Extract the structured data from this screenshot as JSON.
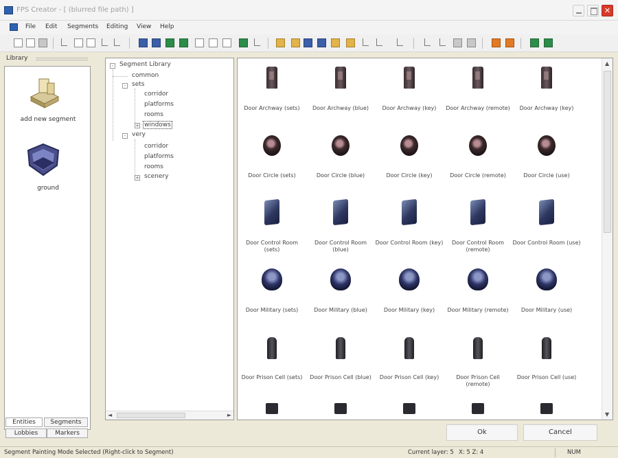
{
  "window": {
    "title": "FPS Creator - [ (blurred file path) ]",
    "close_glyph": "✕"
  },
  "menu": {
    "items": [
      "File",
      "Edit",
      "Segments",
      "Editing",
      "View",
      "Help"
    ]
  },
  "toolbar": {
    "icons": [
      "new-icon",
      "open-icon",
      "save-icon",
      "cut-icon",
      "copy-icon",
      "paste-icon",
      "undo-icon",
      "redo-icon",
      "view-icon",
      "map-icon",
      "build-icon",
      "test-icon",
      "entity-icon",
      "waypoint-icon",
      "zoom-icon",
      "draw-icon",
      "settings-icon",
      "help-icon",
      "play-icon"
    ]
  },
  "library": {
    "label": "Library",
    "items": [
      {
        "label": "add new segment",
        "icon": "add-segment-icon"
      },
      {
        "label": "ground",
        "icon": "ground-icon"
      }
    ],
    "tabs": [
      "Entities",
      "Segments",
      "Lobbies",
      "Markers"
    ]
  },
  "tree": {
    "root": "Segment Library",
    "nodes": [
      {
        "label": "common",
        "indent": 1
      },
      {
        "label": "sets",
        "indent": 1
      },
      {
        "label": "corridor",
        "indent": 2
      },
      {
        "label": "platforms",
        "indent": 2
      },
      {
        "label": "rooms",
        "indent": 2
      },
      {
        "label": "windows",
        "indent": 2,
        "selected": true
      },
      {
        "label": "very",
        "indent": 1
      },
      {
        "label": "corridor",
        "indent": 2
      },
      {
        "label": "platforms",
        "indent": 2
      },
      {
        "label": "rooms",
        "indent": 2
      },
      {
        "label": "scenery",
        "indent": 2
      }
    ]
  },
  "grid": {
    "rows": [
      {
        "shape": "arch",
        "labels": [
          "Door Archway (sets)",
          "Door Archway (blue)",
          "Door Archway (key)",
          "Door Archway (remote)",
          "Door Archway (key)"
        ]
      },
      {
        "shape": "round",
        "labels": [
          "Door Circle (sets)",
          "Door Circle (blue)",
          "Door Circle (key)",
          "Door Circle (remote)",
          "Door Circle (use)"
        ]
      },
      {
        "shape": "square",
        "labels": [
          "Door Control Room (sets)",
          "Door Control Room (blue)",
          "Door Control Room (key)",
          "Door Control Room (remote)",
          "Door Control Room (use)"
        ]
      },
      {
        "shape": "military",
        "labels": [
          "Door Military (sets)",
          "Door Military (blue)",
          "Door Military (key)",
          "Door Military (remote)",
          "Door Military (use)"
        ]
      },
      {
        "shape": "prison",
        "labels": [
          "Door Prison Cell (sets)",
          "Door Prison Cell (blue)",
          "Door Prison Cell (key)",
          "Door Prison Cell (remote)",
          "Door Prison Cell (use)"
        ]
      },
      {
        "shape": "partial",
        "labels": [
          "",
          "",
          "",
          "",
          ""
        ]
      }
    ]
  },
  "buttons": {
    "ok": "Ok",
    "cancel": "Cancel"
  },
  "status": {
    "left": "Segment Painting Mode Selected (Right-click to Segment)",
    "middle": "Current layer: 5",
    "coords": "X: 5  Z: 4",
    "right": "NUM"
  }
}
